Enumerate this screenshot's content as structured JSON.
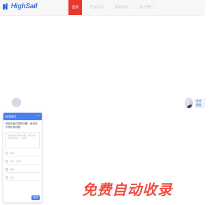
{
  "brand": {
    "logo_text": "HighSail",
    "accent": "#2f6bd6"
  },
  "nav": {
    "items": [
      {
        "label": "首页",
        "active": true
      },
      {
        "label": "产品中心",
        "active": false
      },
      {
        "label": "新闻资讯",
        "active": false
      },
      {
        "label": "关于我们",
        "active": false
      }
    ],
    "active_color": "#e8372f"
  },
  "customer_service": {
    "label": "在线客服"
  },
  "chat": {
    "title": "给我留言",
    "minimize_label": "—",
    "message": "请告诉我们您的问题，我们会尽快给您回复！",
    "textarea_placeholder": "请在此输入留言内容，我们会尽快与您联系。（必填）",
    "fields": [
      {
        "placeholder": "姓名"
      },
      {
        "placeholder": "电话（必填）"
      },
      {
        "placeholder": "邮箱"
      },
      {
        "placeholder": "地址"
      }
    ],
    "send_label": "发送",
    "header_color": "#4a7df0"
  },
  "watermark": {
    "text": "免费自动收录"
  }
}
